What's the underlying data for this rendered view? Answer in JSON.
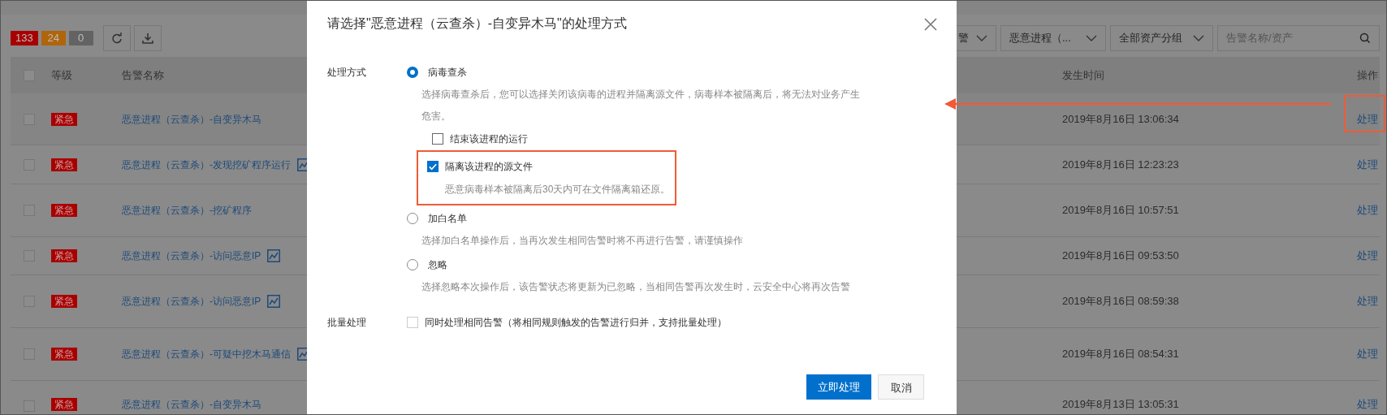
{
  "counters": [
    {
      "text": "133",
      "color": "#a80000"
    },
    {
      "text": "24",
      "color": "#b0650a"
    },
    {
      "text": "0",
      "color": "#636363"
    }
  ],
  "filters": [
    {
      "kind": "select",
      "value": "警"
    },
    {
      "kind": "select",
      "value": "恶意进程（..."
    },
    {
      "kind": "select",
      "value": "全部资产分组"
    },
    {
      "kind": "search",
      "placeholder": "告警名称/资产"
    }
  ],
  "table": {
    "select_all_checked": false,
    "columns": [
      "等级",
      "告警名称",
      "发生时间",
      "操作"
    ],
    "rows": [
      {
        "checked": false,
        "level": "紧急",
        "name": "恶意进程（云查杀）-自变异木马",
        "has_chart_icon": false,
        "time": "2019年8月16日 13:06:34",
        "action": "处理"
      },
      {
        "checked": false,
        "level": "紧急",
        "name": "恶意进程（云查杀）-发现挖矿程序运行",
        "has_chart_icon": true,
        "time": "2019年8月16日 12:23:23",
        "action": "处理"
      },
      {
        "checked": false,
        "level": "紧急",
        "name": "恶意进程（云查杀）-挖矿程序",
        "has_chart_icon": false,
        "time": "2019年8月16日 10:57:51",
        "action": "处理"
      },
      {
        "checked": false,
        "level": "紧急",
        "name": "恶意进程（云查杀）-访问恶意IP",
        "has_chart_icon": true,
        "time": "2019年8月16日 09:53:50",
        "action": "处理"
      },
      {
        "checked": false,
        "level": "紧急",
        "name": "恶意进程（云查杀）-访问恶意IP",
        "has_chart_icon": true,
        "time": "2019年8月16日 08:59:38",
        "action": "处理"
      },
      {
        "checked": false,
        "level": "紧急",
        "name": "恶意进程（云查杀）-可疑中挖木马通信",
        "has_chart_icon": true,
        "time": "2019年8月16日 08:54:31",
        "action": "处理"
      },
      {
        "checked": false,
        "level": "紧急",
        "name": "恶意进程（云查杀）-自变异木马",
        "has_chart_icon": false,
        "time": "2019年8月13日 13:05:31",
        "action": "处理"
      }
    ]
  },
  "dialog": {
    "title": "请选择\"恶意进程（云查杀）-自变异木马\"的处理方式",
    "method_label": "处理方式",
    "options": [
      {
        "label": "病毒查杀",
        "selected": true,
        "description": "选择病毒查杀后，您可以选择关闭该病毒的进程并隔离源文件，病毒样本被隔离后，将无法对业务产生危害。",
        "suboptions": [
          {
            "label": "结束该进程的运行",
            "checked": false
          },
          {
            "label": "隔离该进程的源文件",
            "checked": true,
            "note": "恶意病毒样本被隔离后30天内可在文件隔离箱还原。"
          }
        ]
      },
      {
        "label": "加白名单",
        "selected": false,
        "description": "选择加白名单操作后，当再次发生相同告警时将不再进行告警，请谨慎操作"
      },
      {
        "label": "忽略",
        "selected": false,
        "description": "选择忽略本次操作后，该告警状态将更新为已忽略，当相同告警再次发生时，云安全中心将再次告警"
      }
    ],
    "batch_label": "批量处理",
    "batch_option": {
      "label": "同时处理相同告警（将相同规则触发的告警进行归并，支持批量处理）",
      "checked": false
    },
    "buttons": [
      {
        "label": "立即处理",
        "kind": "primary"
      },
      {
        "label": "取消",
        "kind": "secondary"
      }
    ]
  }
}
